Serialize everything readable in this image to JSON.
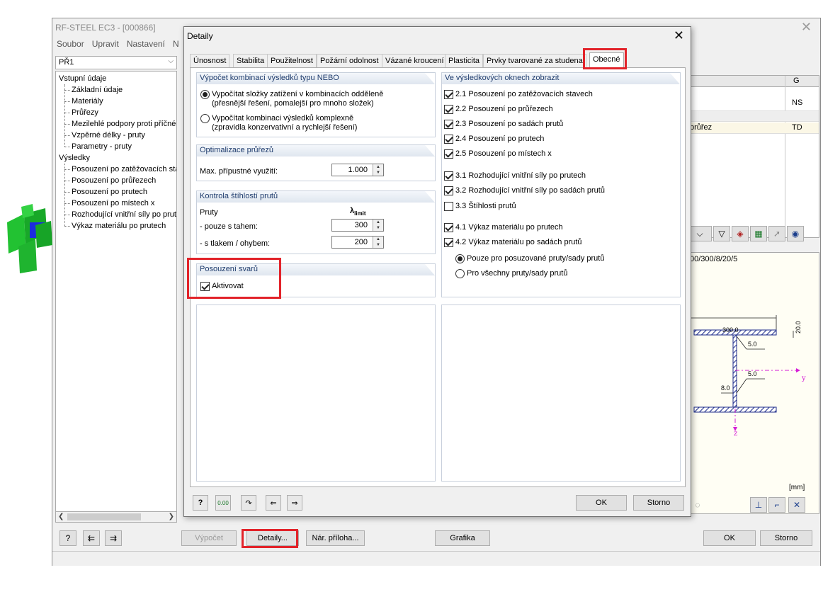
{
  "main_window": {
    "title": "RF-STEEL EC3 - [000866]",
    "menu": [
      "Soubor",
      "Upravit",
      "Nastavení",
      "N"
    ],
    "case_select": "PŘ1",
    "tree": {
      "input_root": "Vstupní údaje",
      "input_items": [
        "Základní údaje",
        "Materiály",
        "Průřezy",
        "Mezilehlé podpory proti příčném",
        "Vzpěrné délky - pruty",
        "Parametry - pruty"
      ],
      "results_root": "Výsledky",
      "results_items": [
        "Posouzení po zatěžovacích stav",
        "Posouzení po průřezech",
        "Posouzení po prutech",
        "Posouzení po místech x",
        "Rozhodující vnitřní síly po prute",
        "Výkaz materiálu po prutech"
      ]
    },
    "buttons": {
      "calculation": "Výpočet",
      "details": "Detaily...",
      "national_annex": "Nár. příloha...",
      "graphics": "Grafika",
      "ok": "OK",
      "cancel": "Storno"
    },
    "table": {
      "col_g": "G",
      "cell_ns": "NS",
      "cell_prurez": "průřez",
      "cell_td": "TD"
    },
    "preview": {
      "section_label": "00/300/8/20/5",
      "dim_width": "300.0",
      "dim_flange": "20.0",
      "weld_top": "5.0",
      "web_thickness": "8.0",
      "weld_bottom": "5.0",
      "axis_y": "y",
      "axis_z": "z",
      "unit": "[mm]"
    },
    "colors": {
      "highlight": "#e2232a",
      "group_title": "#1f3c6d",
      "drawing_blue": "#1c2b8a",
      "axis_magenta": "#d61fd6"
    }
  },
  "dialog": {
    "title": "Detaily",
    "tabs": [
      "Únosnost",
      "Stabilita",
      "Použitelnost",
      "Požární odolnost",
      "Vázané kroucení",
      "Plasticita",
      "Prvky tvarované za studena",
      "Obecné"
    ],
    "active_tab": "Obecné",
    "nebo": {
      "title": "Výpočet kombinací výsledků typu NEBO",
      "option1_line1": "Vypočítat složky zatížení v kombinacích odděleně",
      "option1_line2": "(přesnější řešení, pomalejší pro mnoho složek)",
      "option2_line1": "Vypočítat kombinaci výsledků komplexně",
      "option2_line2": "(zpravidla konzervativní a rychlejší řešení)",
      "selected": 1
    },
    "optimization": {
      "title": "Optimalizace průřezů",
      "label": "Max. přípustné využití:",
      "value": "1.000"
    },
    "slenderness": {
      "title": "Kontrola štíhlostí prutů",
      "members_label": "Pruty",
      "lambda_symbol": "λ",
      "lambda_sub": "limit",
      "tension_label": "- pouze s tahem:",
      "tension_value": "300",
      "compression_label": "- s tlakem / ohybem:",
      "compression_value": "200"
    },
    "welds": {
      "title": "Posouzení svarů",
      "activate_label": "Aktivovat",
      "checked": true
    },
    "display": {
      "title": "Ve výsledkových oknech zobrazit",
      "items": [
        {
          "label": "2.1 Posouzení po zatěžovacích stavech",
          "checked": true
        },
        {
          "label": "2.2 Posouzení po průřezech",
          "checked": true
        },
        {
          "label": "2.3 Posouzení po sadách prutů",
          "checked": true
        },
        {
          "label": "2.4 Posouzení po prutech",
          "checked": true
        },
        {
          "label": "2.5 Posouzení po místech x",
          "checked": true
        },
        {
          "label": "3.1 Rozhodující vnitřní síly po prutech",
          "checked": true
        },
        {
          "label": "3.2 Rozhodující vnitřní síly po sadách prutů",
          "checked": true
        },
        {
          "label": "3.3 Štíhlosti prutů",
          "checked": false
        },
        {
          "label": "4.1 Výkaz materiálu po prutech",
          "checked": true
        },
        {
          "label": "4.2 Výkaz materiálu po sadách prutů",
          "checked": true
        }
      ],
      "radio1": "Pouze pro posuzované pruty/sady prutů",
      "radio2": "Pro všechny pruty/sady prutů",
      "radio_selected": 1
    },
    "bottom_icons": [
      "help-icon",
      "units-icon",
      "redo-icon",
      "import-icon",
      "export-icon"
    ],
    "units_icon_text": "0.00",
    "buttons": {
      "ok": "OK",
      "cancel": "Storno"
    }
  }
}
